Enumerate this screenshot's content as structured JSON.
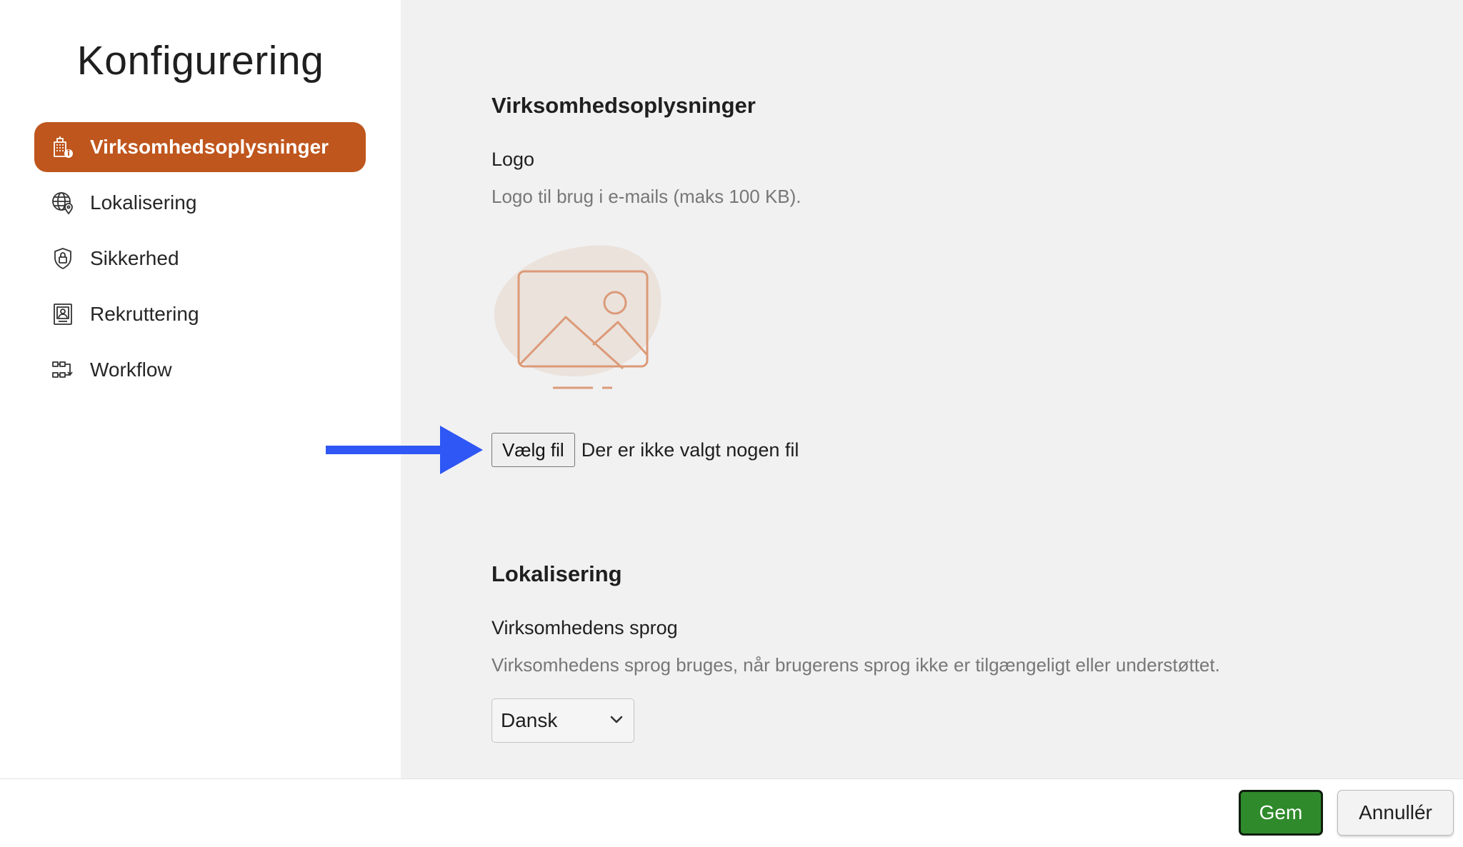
{
  "sidebar": {
    "title": "Konfigurering",
    "items": [
      {
        "label": "Virksomhedsoplysninger",
        "icon": "building-info-icon",
        "active": true
      },
      {
        "label": "Lokalisering",
        "icon": "globe-pin-icon",
        "active": false
      },
      {
        "label": "Sikkerhed",
        "icon": "shield-lock-icon",
        "active": false
      },
      {
        "label": "Rekruttering",
        "icon": "id-card-icon",
        "active": false
      },
      {
        "label": "Workflow",
        "icon": "workflow-icon",
        "active": false
      }
    ]
  },
  "company": {
    "section_title": "Virksomhedsoplysninger",
    "logo_label": "Logo",
    "logo_help": "Logo til brug i e-mails (maks 100 KB).",
    "logo_placeholder_icon": "image-placeholder-icon",
    "file_button": "Vælg fil",
    "file_status": "Der er ikke valgt nogen fil"
  },
  "localization": {
    "section_title": "Lokalisering",
    "language_label": "Virksomhedens sprog",
    "language_help": "Virksomhedens sprog bruges, når brugerens sprog ikke er tilgængeligt eller understøttet.",
    "language_value": "Dansk"
  },
  "footer": {
    "save_label": "Gem",
    "cancel_label": "Annullér"
  },
  "colors": {
    "accent": "#bf561d",
    "save": "#2f8a2b",
    "annotation_arrow": "#2f57f5",
    "illustration": "#dc9a78"
  }
}
